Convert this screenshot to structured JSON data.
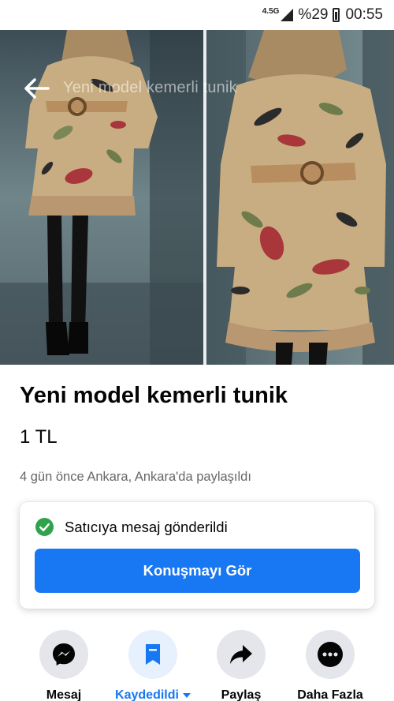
{
  "status_bar": {
    "network": "4.5G",
    "battery": "%29",
    "time": "00:55"
  },
  "listing": {
    "overlay_title": "Yeni model kemerli tunik",
    "title": "Yeni model kemerli tunik",
    "price": "1 TL",
    "meta": "4 gün önce Ankara, Ankara'da paylaşıldı",
    "photo_count": 3,
    "active_photo": 2
  },
  "message_card": {
    "status": "Satıcıya mesaj gönderildi",
    "button": "Konuşmayı Gör"
  },
  "actions": [
    {
      "label": "Mesaj",
      "icon": "messenger-icon"
    },
    {
      "label": "Kaydedildi",
      "icon": "bookmark-icon"
    },
    {
      "label": "Paylaş",
      "icon": "share-icon"
    },
    {
      "label": "Daha Fazla",
      "icon": "more-icon"
    }
  ],
  "colors": {
    "accent": "#1877f2",
    "success": "#31a24c",
    "muted_text": "#65676b"
  }
}
